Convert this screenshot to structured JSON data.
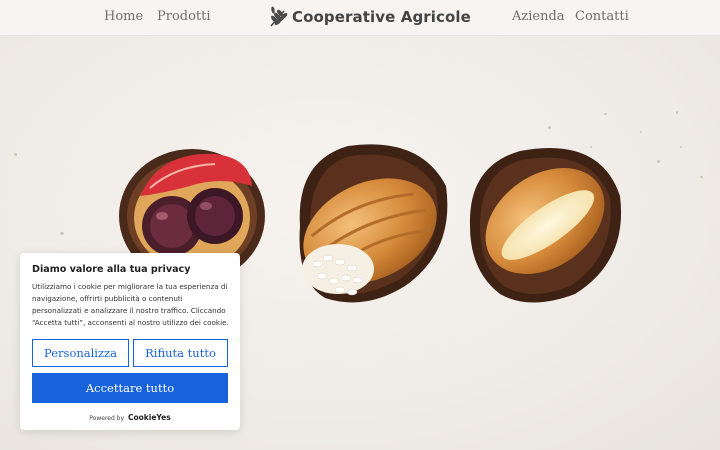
{
  "header": {
    "nav_left": [
      "Home",
      "Prodotti"
    ],
    "logo_text": "Cooperative Agricole",
    "logo_icon": "wheat-icon",
    "nav_right": [
      "Azienda",
      "Contatti"
    ]
  },
  "cookie": {
    "title": "Diamo valore alla tua privacy",
    "body": "Utilizziamo i cookie per migliorare la tua esperienza di navigazione, offrirti pubblicità o contenuti personalizzati e analizzare il nostro traffico. Cliccando “Accetta tutti”, acconsenti al nostro utilizzo dei cookie.",
    "customize_label": "Personalizza",
    "reject_label": "Rifiuta tutto",
    "accept_label": "Accettare tutto",
    "powered_by": "Powered by",
    "powered_brand": "CookieYes"
  },
  "colors": {
    "accent": "#1863dc",
    "header_bg": "#f7f4f1",
    "nav_text": "#6f6f6f"
  }
}
